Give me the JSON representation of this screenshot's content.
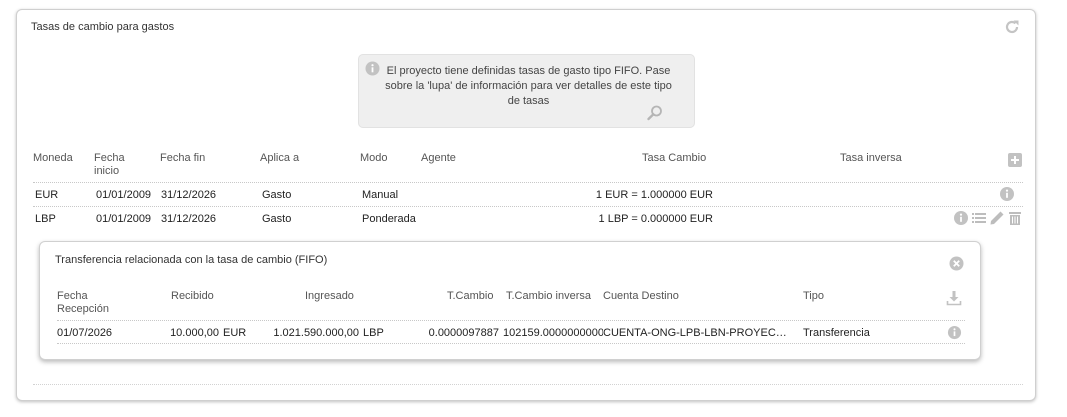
{
  "panel": {
    "title": "Tasas de cambio para gastos",
    "info_message": "El proyecto tiene definidas tasas de gasto tipo FIFO. Pase sobre la 'lupa' de información para ver detalles de este tipo de tasas"
  },
  "grid": {
    "headers": {
      "moneda": "Moneda",
      "fecha_inicio": "Fecha inicio",
      "fecha_fin": "Fecha fin",
      "aplica_a": "Aplica a",
      "modo": "Modo",
      "agente": "Agente",
      "tasa_cambio": "Tasa Cambio",
      "tasa_inversa": "Tasa inversa"
    },
    "rows": [
      {
        "moneda": "EUR",
        "fecha_inicio": "01/01/2009",
        "fecha_fin": "31/12/2026",
        "aplica_a": "Gasto",
        "modo": "Manual",
        "agente": "",
        "tasa_cambio": "1 EUR = 1.000000 EUR",
        "tasa_inversa": ""
      },
      {
        "moneda": "LBP",
        "fecha_inicio": "01/01/2009",
        "fecha_fin": "31/12/2026",
        "aplica_a": "Gasto",
        "modo": "Ponderada",
        "agente": "",
        "tasa_cambio": "1 LBP = 0.000000 EUR",
        "tasa_inversa": ""
      }
    ]
  },
  "transfer_panel": {
    "title": "Transferencia relacionada con la tasa de cambio (FIFO)",
    "headers": {
      "fecha": "Fecha Recepción",
      "recibido": "Recibido",
      "ingresado": "Ingresado",
      "tcambio": "T.Cambio",
      "tcambio_inversa": "T.Cambio inversa",
      "cuenta": "Cuenta Destino",
      "tipo": "Tipo"
    },
    "row": {
      "fecha": "01/07/2026",
      "recibido": "10.000,00",
      "recibido_moneda": "EUR",
      "ingresado": "1.021.590.000,00",
      "ingresado_moneda": "LBP",
      "tcambio": "0.0000097887",
      "tcambio_inversa": "102159.0000000000",
      "cuenta": "CUENTA-ONG-LPB-LBN-PROYEC…",
      "tipo": "Transferencia"
    }
  },
  "colors": {
    "icon_gray": "#b9b9b9",
    "border": "#cfcfcf",
    "info_bg": "#efefef"
  }
}
